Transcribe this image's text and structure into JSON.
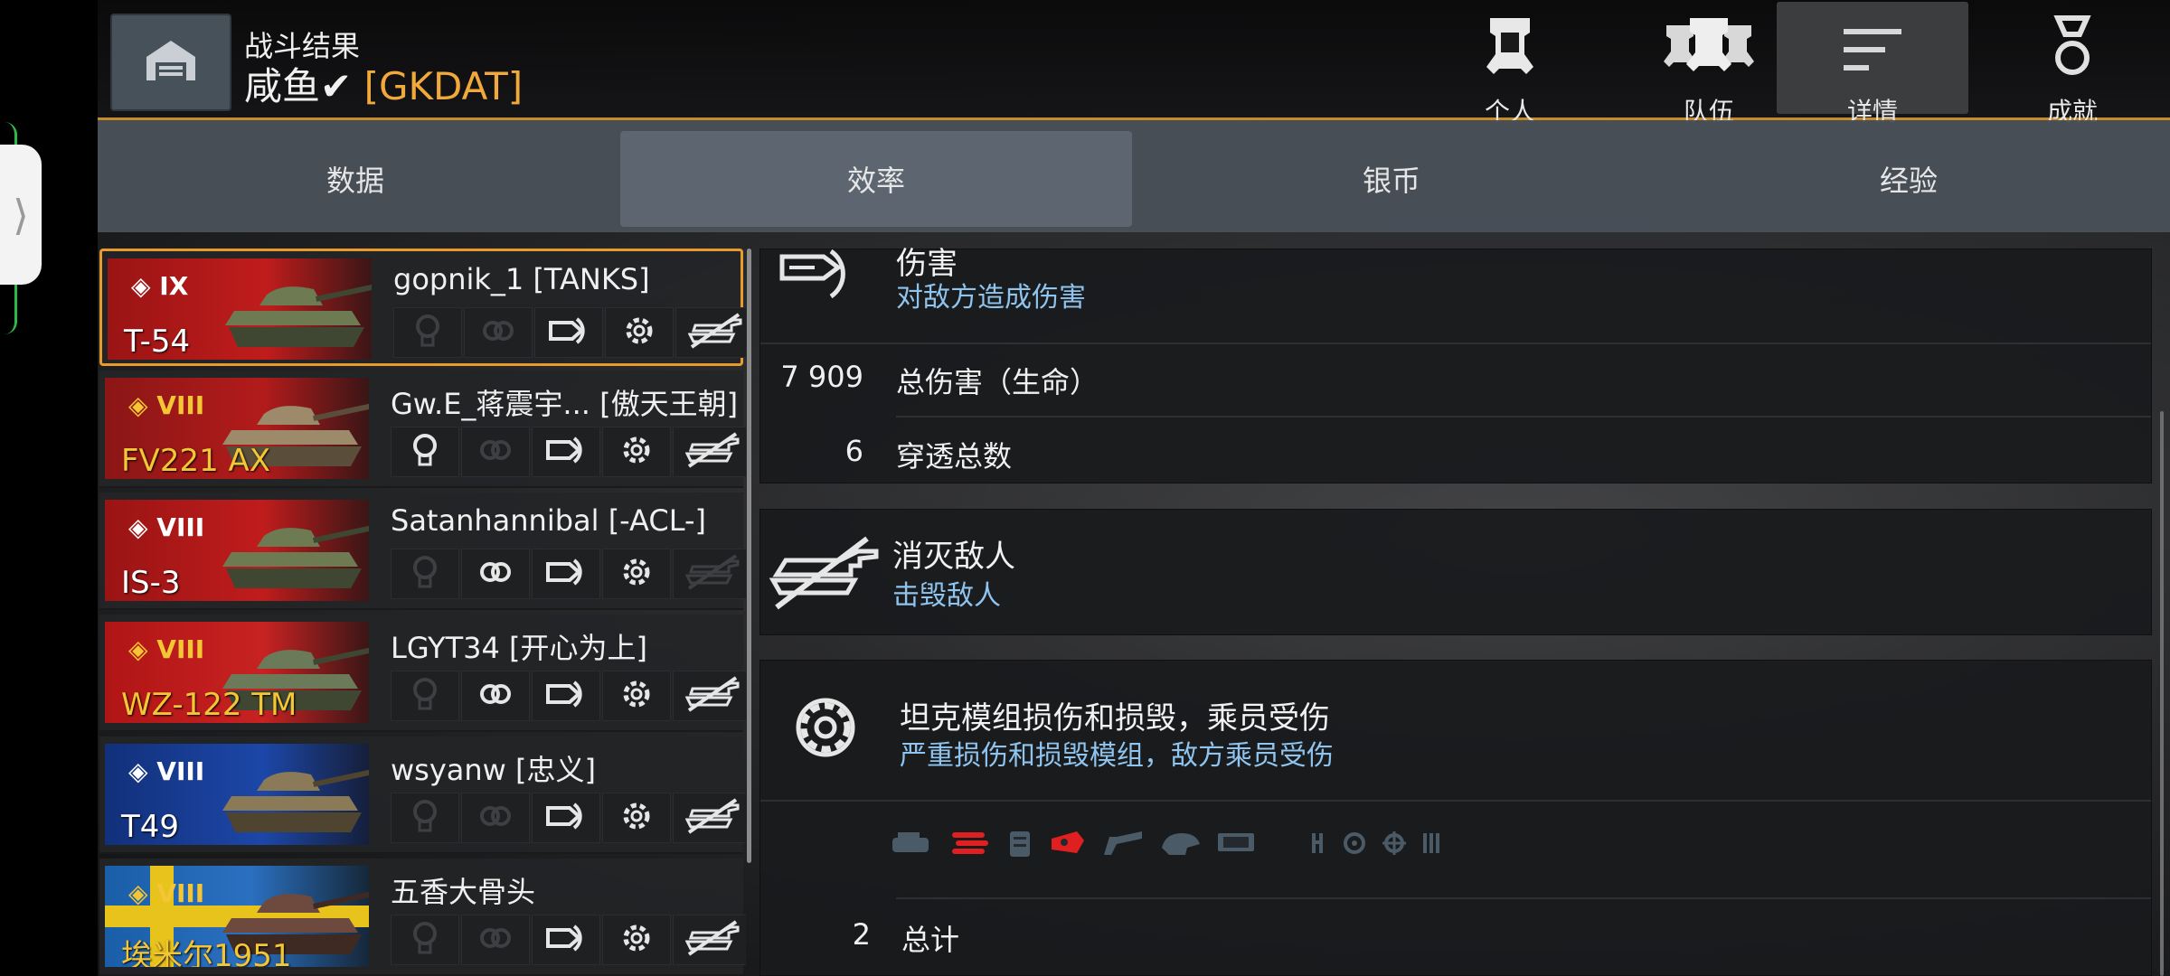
{
  "header": {
    "subtitle": "战斗结果",
    "player_name": "咸鱼✔",
    "clan_tag": "[GKDAT]",
    "nav": [
      {
        "label": "个人",
        "icon": "single-soldier-icon",
        "active": false
      },
      {
        "label": "队伍",
        "icon": "team-icon",
        "active": false
      },
      {
        "label": "详情",
        "icon": "details-lines-icon",
        "active": true
      },
      {
        "label": "成就",
        "icon": "medal-icon",
        "active": false
      }
    ]
  },
  "tabs": [
    {
      "label": "数据",
      "active": false
    },
    {
      "label": "效率",
      "active": true
    },
    {
      "label": "银币",
      "active": false
    },
    {
      "label": "经验",
      "active": false
    }
  ],
  "players": [
    {
      "tier": "IX",
      "tank": "T-54",
      "name": "gopnik_1 [TANKS]",
      "nation": "ussr",
      "premium": false,
      "selected": true,
      "efficiency": [
        false,
        false,
        true,
        true,
        true
      ]
    },
    {
      "tier": "VIII",
      "tank": "FV221 AX",
      "name": "Gw.E_蒋震宇...  [傲天王朝]",
      "nation": "uk",
      "premium": true,
      "selected": false,
      "efficiency": [
        true,
        false,
        true,
        true,
        true
      ]
    },
    {
      "tier": "VIII",
      "tank": "IS-3",
      "name": "Satanhannibal [-ACL-]",
      "nation": "ussr",
      "premium": false,
      "selected": false,
      "efficiency": [
        false,
        true,
        true,
        true,
        false
      ]
    },
    {
      "tier": "VIII",
      "tank": "WZ-122 TM",
      "name": "LGYT34 [开心为上]",
      "nation": "china",
      "premium": true,
      "selected": false,
      "efficiency": [
        false,
        true,
        true,
        true,
        true
      ]
    },
    {
      "tier": "VIII",
      "tank": "T49",
      "name": "wsyanw [忠义]",
      "nation": "usa",
      "premium": false,
      "selected": false,
      "efficiency": [
        false,
        false,
        true,
        true,
        true
      ]
    },
    {
      "tier": "VIII",
      "tank": "埃米尔1951",
      "name": "五香大骨头",
      "nation": "sweden",
      "premium": true,
      "selected": false,
      "efficiency": [
        false,
        false,
        true,
        true,
        true
      ]
    }
  ],
  "details": {
    "damage": {
      "title": "伤害",
      "subtitle": "对敌方造成伤害",
      "rows": [
        {
          "value": "7 909",
          "label": "总伤害（生命）"
        },
        {
          "value": "6",
          "label": "穿透总数"
        }
      ]
    },
    "kills": {
      "title": "消灭敌人",
      "subtitle": "击毁敌人"
    },
    "modules": {
      "title": "坦克模组损伤和损毁，乘员受伤",
      "subtitle": "严重损伤和损毁模组，敌方乘员受伤",
      "icons": [
        "engine-icon",
        "tracks-icon",
        "fuel-tank-icon",
        "ammo-rack-icon",
        "gun-icon",
        "turret-icon",
        "radio-icon",
        "crew-icon",
        "driver-icon",
        "gunner-icon",
        "loader-icon"
      ],
      "damaged_color": "#e02020",
      "rows": [
        {
          "value": "2",
          "label": "总计"
        }
      ]
    }
  },
  "colors": {
    "accent": "#e89a2a",
    "clan": "#f0a93a",
    "premium_tier": "#f4c534",
    "subtitle_blue": "#8fc4ef"
  }
}
